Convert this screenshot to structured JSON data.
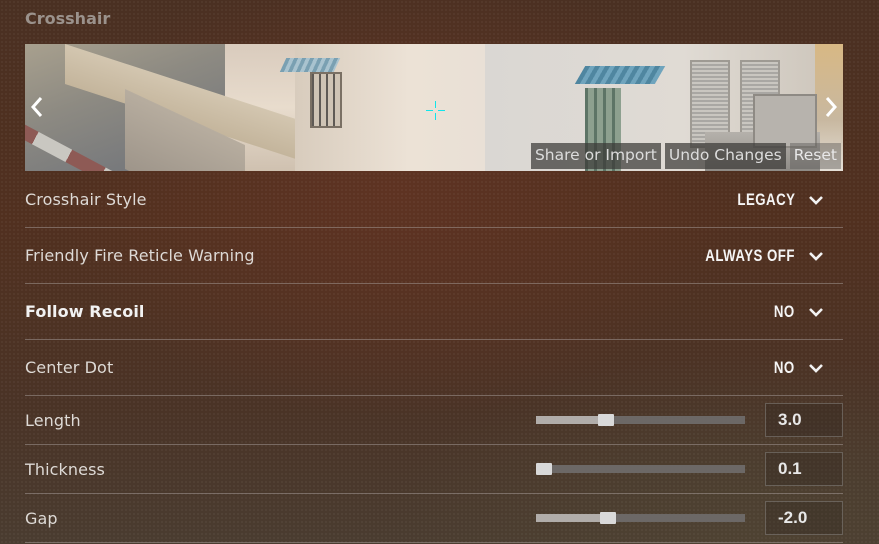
{
  "section": {
    "title": "Crosshair"
  },
  "preview": {
    "crosshair_color": "#12e5ea",
    "prev_icon": "chevron-left-icon",
    "next_icon": "chevron-right-icon",
    "actions": {
      "share": "Share or Import",
      "undo": "Undo Changes",
      "reset": "Reset"
    }
  },
  "settings": {
    "dropdowns": [
      {
        "label": "Crosshair Style",
        "value": "LEGACY",
        "bold": false
      },
      {
        "label": "Friendly Fire Reticle Warning",
        "value": "ALWAYS OFF",
        "bold": false
      },
      {
        "label": "Follow Recoil",
        "value": "NO",
        "bold": true
      },
      {
        "label": "Center Dot",
        "value": "NO",
        "bold": false
      }
    ],
    "sliders": [
      {
        "label": "Length",
        "value": "3.0",
        "fraction": 0.32
      },
      {
        "label": "Thickness",
        "value": "0.1",
        "fraction": 0.0
      },
      {
        "label": "Gap",
        "value": "-2.0",
        "fraction": 0.33
      }
    ]
  }
}
